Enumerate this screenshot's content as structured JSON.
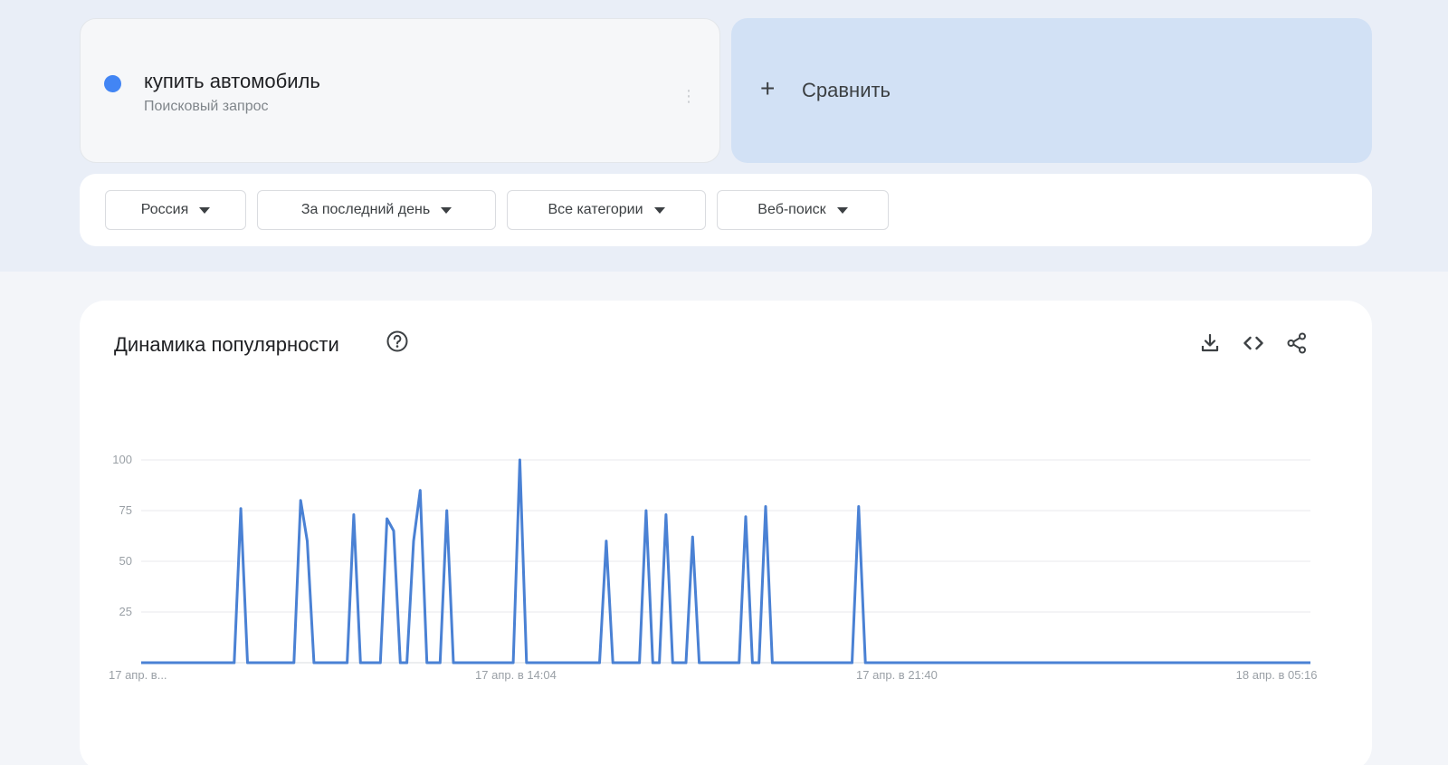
{
  "search_term": {
    "title": "купить автомобиль",
    "subtitle": "Поисковый запрос",
    "color": "#4285f4"
  },
  "compare": {
    "label": "Сравнить",
    "icon": "plus-icon"
  },
  "filters": [
    {
      "label": "Россия"
    },
    {
      "label": "За последний день"
    },
    {
      "label": "Все категории"
    },
    {
      "label": "Веб-поиск"
    }
  ],
  "chart_panel": {
    "title": "Динамика популярности",
    "help_icon": "help-circle-icon",
    "tools": [
      "download-icon",
      "embed-code-icon",
      "share-icon"
    ]
  },
  "chart_data": {
    "type": "line",
    "title": "",
    "xlabel": "",
    "ylabel": "",
    "ylim": [
      0,
      100
    ],
    "yticks": [
      25,
      50,
      75,
      100
    ],
    "grid": true,
    "x_tick_labels": [
      "17 апр. в...",
      "17 апр. в 14:04",
      "17 апр. в 21:40",
      "18 апр. в 05:16"
    ],
    "color": "#4a81d4",
    "series": [
      {
        "values": [
          0,
          0,
          0,
          0,
          0,
          0,
          0,
          0,
          0,
          0,
          0,
          0,
          0,
          0,
          0,
          76,
          0,
          0,
          0,
          0,
          0,
          0,
          0,
          0,
          80,
          60,
          0,
          0,
          0,
          0,
          0,
          0,
          73,
          0,
          0,
          0,
          0,
          71,
          65,
          0,
          0,
          60,
          85,
          0,
          0,
          0,
          75,
          0,
          0,
          0,
          0,
          0,
          0,
          0,
          0,
          0,
          0,
          100,
          0,
          0,
          0,
          0,
          0,
          0,
          0,
          0,
          0,
          0,
          0,
          0,
          60,
          0,
          0,
          0,
          0,
          0,
          75,
          0,
          0,
          73,
          0,
          0,
          0,
          62,
          0,
          0,
          0,
          0,
          0,
          0,
          0,
          72,
          0,
          0,
          77,
          0,
          0,
          0,
          0,
          0,
          0,
          0,
          0,
          0,
          0,
          0,
          0,
          0,
          77,
          0,
          0,
          0,
          0,
          0,
          0,
          0,
          0,
          0,
          0,
          0,
          0,
          0,
          0,
          0,
          0,
          0,
          0,
          0,
          0,
          0,
          0,
          0,
          0,
          0,
          0,
          0,
          0,
          0,
          0,
          0,
          0,
          0,
          0,
          0,
          0,
          0,
          0,
          0,
          0,
          0,
          0,
          0,
          0,
          0,
          0,
          0,
          0,
          0,
          0,
          0,
          0,
          0,
          0,
          0,
          0,
          0,
          0,
          0,
          0,
          0,
          0,
          0,
          0,
          0,
          0,
          0,
          0
        ]
      }
    ]
  }
}
